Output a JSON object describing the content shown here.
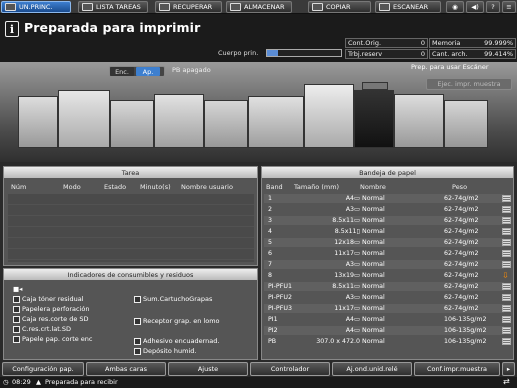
{
  "tabs": [
    {
      "label": "UN.PRINC.",
      "icon": "home-icon",
      "active": true
    },
    {
      "label": "LISTA TAREAS",
      "icon": "job-list-icon"
    },
    {
      "label": "RECUPERAR",
      "icon": "recall-icon"
    },
    {
      "label": "ALMACENAR",
      "icon": "store-icon"
    },
    {
      "label": "COPIAR",
      "icon": "copy-icon"
    },
    {
      "label": "ESCANEAR",
      "icon": "scan-icon"
    }
  ],
  "header": {
    "title": "Preparada para imprimir",
    "cuerpo_label": "Cuerpo prin.",
    "cuerpo_progress": 0.15
  },
  "stats": {
    "cont_orig_label": "Cont.Orig.",
    "cont_orig_value": "0",
    "trbj_label": "Trbj.reserv",
    "trbj_value": "0",
    "memoria_label": "Memoria",
    "memoria_value": "99.999%",
    "cant_label": "Cant. arch.",
    "cant_value": "99.414%"
  },
  "printer": {
    "enc_label": "Enc.",
    "ap_label": "Ap.",
    "pb_status": "PB apagado",
    "prep_label": "Prep. para usar Escáner",
    "ejec_label": "Ejec. impr. muestra"
  },
  "tarea": {
    "title": "Tarea",
    "columns": [
      "Núm",
      "Modo",
      "Estado",
      "Minuto(s)",
      "Nombre usuario"
    ]
  },
  "consumibles": {
    "title": "Indicadores de consumibles y residuos",
    "items_left": [
      "Caja tóner residual",
      "Papelera perforación",
      "Caja res.corte de SD",
      "C.res.crt.lat.SD",
      "Papele pap. corte enc"
    ],
    "items_right": [
      "Sum.CartuchoGrapas",
      "Receptor grap. en lomo",
      "Adhesivo encuadernad.",
      "Depósito humid."
    ]
  },
  "bandeja": {
    "title": "Bandeja de papel",
    "columns": [
      "Band",
      "Tamaño (mm)",
      "Nombre",
      "Peso"
    ],
    "rows": [
      {
        "band": "1",
        "size": "A4▭",
        "name": "Normal",
        "peso": "62-74g/m2"
      },
      {
        "band": "2",
        "size": "A3▭",
        "name": "Normal",
        "peso": "62-74g/m2"
      },
      {
        "band": "3",
        "size": "8.5x11▭",
        "name": "Normal",
        "peso": "62-74g/m2"
      },
      {
        "band": "4",
        "size": "8.5x11▯",
        "name": "Normal",
        "peso": "62-74g/m2"
      },
      {
        "band": "5",
        "size": "12x18▭",
        "name": "Normal",
        "peso": "62-74g/m2"
      },
      {
        "band": "6",
        "size": "11x17▭",
        "name": "Normal",
        "peso": "62-74g/m2"
      },
      {
        "band": "7",
        "size": "A3▭",
        "name": "Normal",
        "peso": "62-74g/m2"
      },
      {
        "band": "8",
        "size": "13x19▭",
        "name": "Normal",
        "peso": "62-74g/m2"
      },
      {
        "band": "PI-PFU1",
        "size": "8.5x11▭",
        "name": "Normal",
        "peso": "62-74g/m2"
      },
      {
        "band": "PI-PFU2",
        "size": "A3▭",
        "name": "Normal",
        "peso": "62-74g/m2"
      },
      {
        "band": "PI-PFU3",
        "size": "11x17▭",
        "name": "Normal",
        "peso": "62-74g/m2"
      },
      {
        "band": "PI1",
        "size": "A4▭",
        "name": "Normal",
        "peso": "106-135g/m2"
      },
      {
        "band": "PI2",
        "size": "A4▭",
        "name": "Normal",
        "peso": "106-135g/m2"
      },
      {
        "band": "PB",
        "size": "307.0 x 472.0",
        "name": "Normal",
        "peso": "106-135g/m2"
      }
    ]
  },
  "bottom_buttons": [
    "Configuración pap.",
    "Ambas caras",
    "Ajuste",
    "Controlador",
    "Aj.ond.unid.relé",
    "Conf.impr.muestra"
  ],
  "status": {
    "time": "08:29",
    "message": "Preparada para recibir"
  },
  "colors": {
    "active_tab": "#2a62b0",
    "selected_row": "#d9e8fa",
    "warning": "#ff8c00"
  }
}
